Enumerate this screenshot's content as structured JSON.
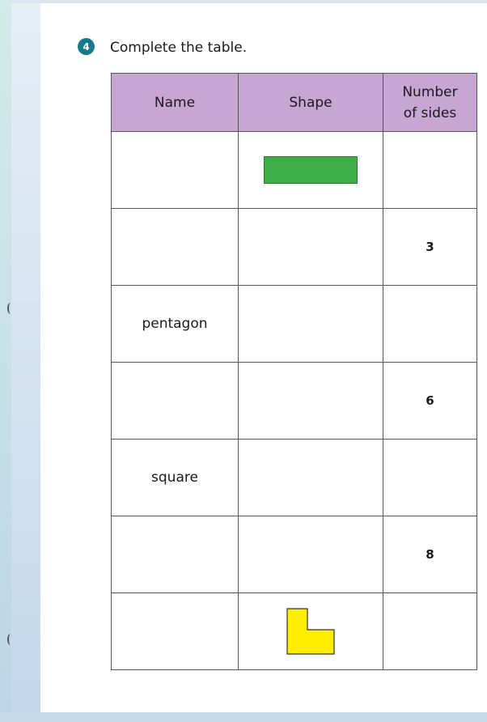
{
  "question": {
    "number": "4",
    "instruction": "Complete the table."
  },
  "table": {
    "headers": {
      "name": "Name",
      "shape": "Shape",
      "sides": "Number of sides"
    },
    "rows": [
      {
        "name": "",
        "shape": "green-rectangle",
        "sides": ""
      },
      {
        "name": "",
        "shape": "",
        "sides": "3"
      },
      {
        "name": "pentagon",
        "shape": "",
        "sides": ""
      },
      {
        "name": "",
        "shape": "",
        "sides": "6"
      },
      {
        "name": "square",
        "shape": "",
        "sides": ""
      },
      {
        "name": "",
        "shape": "",
        "sides": "8"
      },
      {
        "name": "",
        "shape": "yellow-l-shape",
        "sides": ""
      }
    ]
  },
  "colors": {
    "header_background": "#c8a6d3",
    "question_badge": "#157a8c",
    "rectangle_fill": "#3fae49",
    "l_shape_fill": "#ffee00"
  }
}
